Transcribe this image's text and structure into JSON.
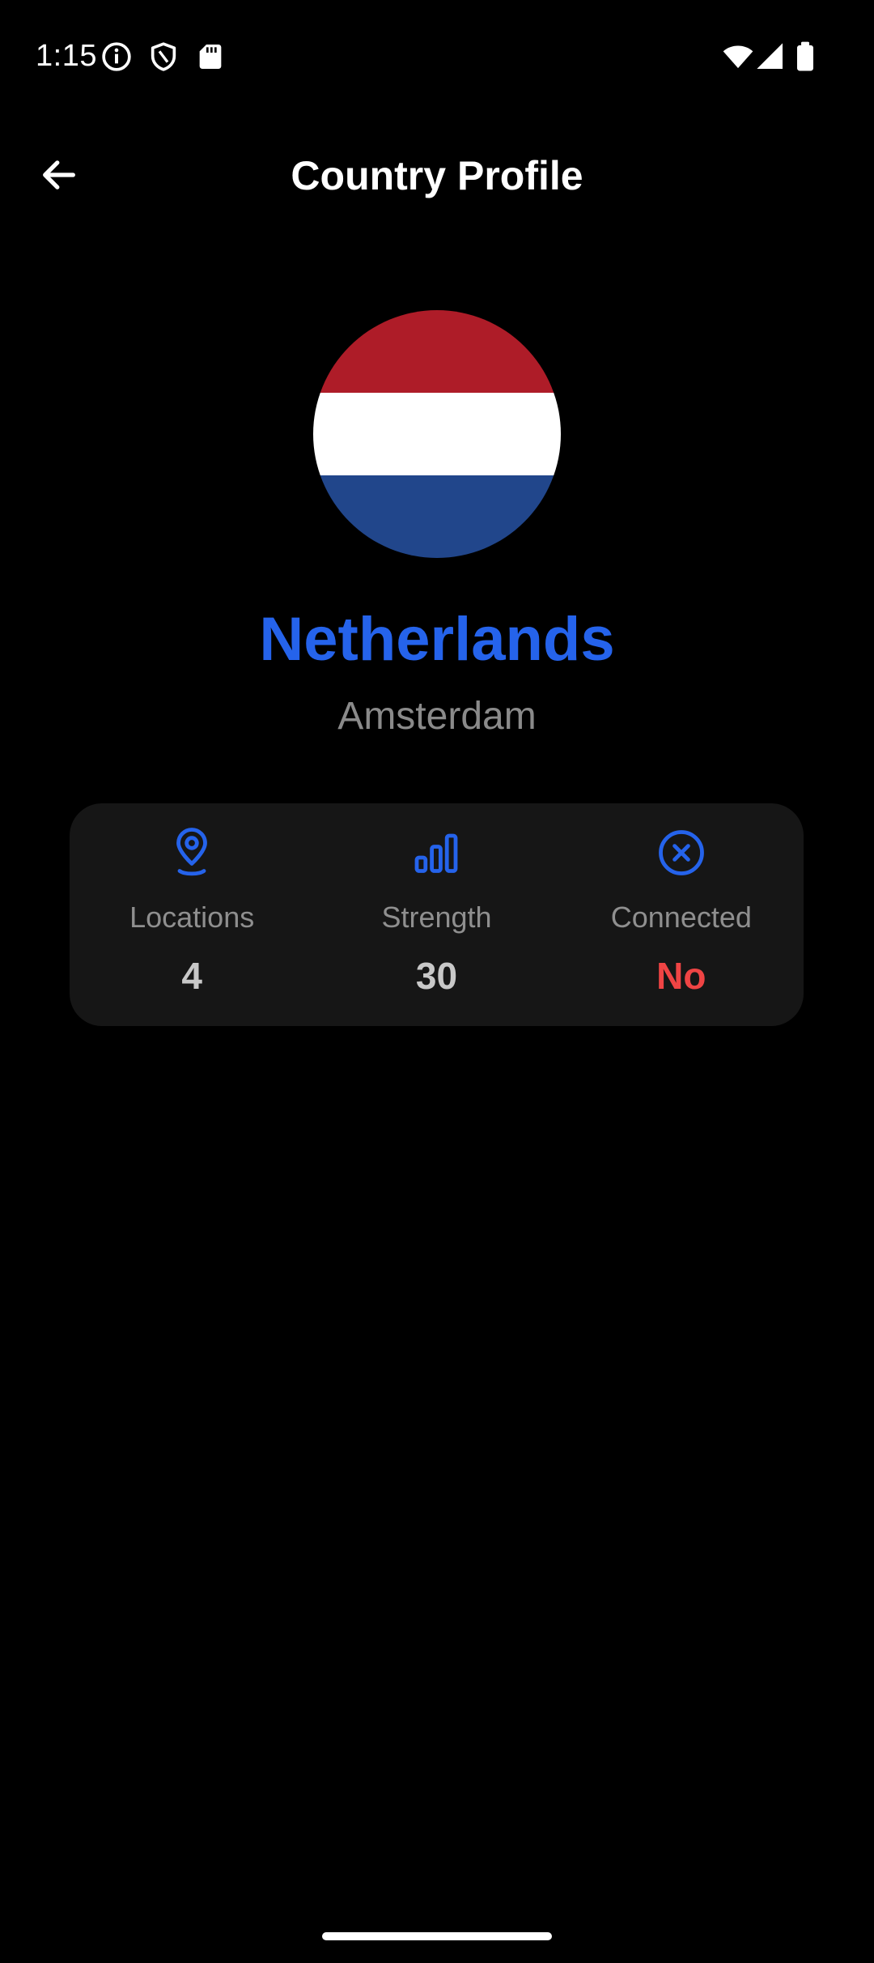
{
  "status_bar": {
    "time": "1:15",
    "icons": [
      "info-icon",
      "shield-icon",
      "sd-card-icon",
      "wifi-icon",
      "cell-signal-icon",
      "battery-icon"
    ]
  },
  "app_bar": {
    "title": "Country Profile",
    "back_icon": "arrow-left-icon"
  },
  "country": {
    "name": "Netherlands",
    "capital": "Amsterdam",
    "flag_colors": [
      "#ae1c28",
      "#ffffff",
      "#21468b"
    ]
  },
  "stats": [
    {
      "icon": "location-pin-icon",
      "label": "Locations",
      "value": "4"
    },
    {
      "icon": "signal-strength-icon",
      "label": "Strength",
      "value": "30"
    },
    {
      "icon": "circle-x-icon",
      "label": "Connected",
      "value": "No"
    }
  ],
  "colors": {
    "background": "#000000",
    "accent": "#2563eb",
    "card": "#161616",
    "negative": "#ef4444",
    "muted_text": "#8f8f8f"
  }
}
